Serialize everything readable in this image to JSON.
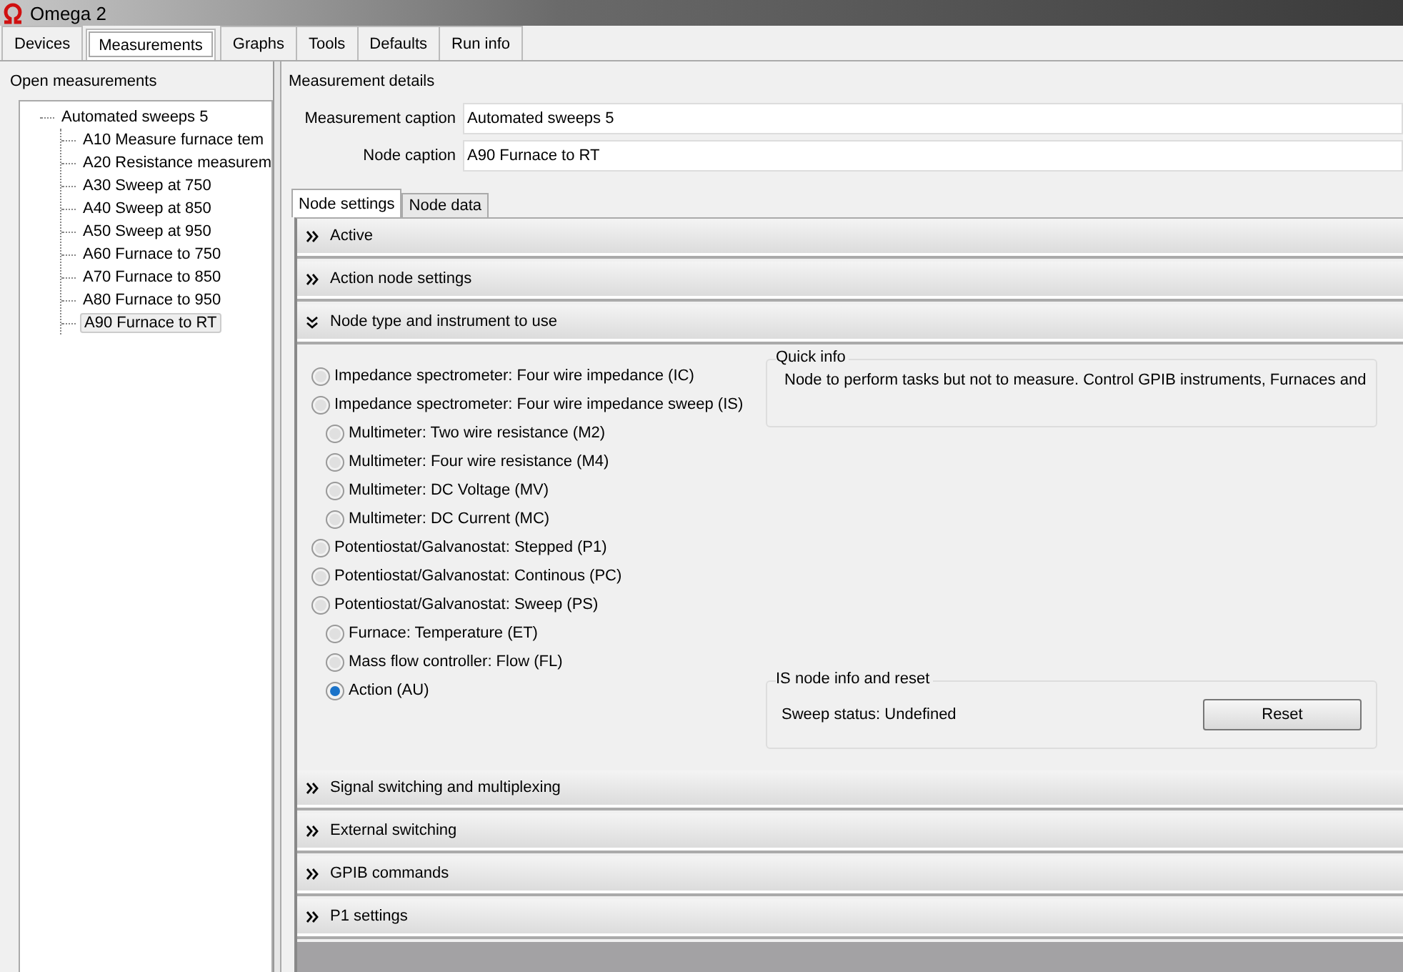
{
  "window": {
    "title": "Omega 2"
  },
  "tabs": [
    {
      "label": "Devices",
      "selected": false
    },
    {
      "label": "Measurements",
      "selected": true
    },
    {
      "label": "Graphs",
      "selected": false
    },
    {
      "label": "Tools",
      "selected": false
    },
    {
      "label": "Defaults",
      "selected": false
    },
    {
      "label": "Run info",
      "selected": false
    }
  ],
  "open_measurements": {
    "title": "Open measurements",
    "tree": [
      {
        "label": "Automated sweeps 5",
        "selected": false,
        "children": [
          {
            "label": "A10 Measure furnace tem",
            "selected": false
          },
          {
            "label": "A20 Resistance measurem",
            "selected": false
          },
          {
            "label": "A30 Sweep at 750",
            "selected": false
          },
          {
            "label": "A40 Sweep at 850",
            "selected": false
          },
          {
            "label": "A50 Sweep at 950",
            "selected": false
          },
          {
            "label": "A60 Furnace to 750",
            "selected": false
          },
          {
            "label": "A70 Furnace to 850",
            "selected": false
          },
          {
            "label": "A80 Furnace to 950",
            "selected": false
          },
          {
            "label": "A90 Furnace to RT",
            "selected": true
          }
        ]
      }
    ]
  },
  "measurement_details": {
    "title": "Measurement details",
    "fields": [
      {
        "label": "Measurement caption",
        "value": "Automated sweeps 5"
      },
      {
        "label": "Node caption",
        "value": "A90 Furnace to RT"
      }
    ]
  },
  "node_tabs": [
    {
      "label": "Node settings",
      "selected": true
    },
    {
      "label": "Node data",
      "selected": false
    }
  ],
  "sections": [
    {
      "title": "Active",
      "expanded": false
    },
    {
      "title": "Action node settings",
      "expanded": false
    },
    {
      "title": "Node type and instrument to use",
      "expanded": true,
      "content": {
        "options": [
          {
            "label": "Impedance spectrometer: Four wire impedance (IC)",
            "indented": false,
            "selected": false
          },
          {
            "label": "Impedance spectrometer: Four wire impedance sweep (IS)",
            "indented": false,
            "selected": false
          },
          {
            "label": "Multimeter: Two wire resistance (M2)",
            "indented": true,
            "selected": false
          },
          {
            "label": "Multimeter: Four wire resistance (M4)",
            "indented": true,
            "selected": false
          },
          {
            "label": "Multimeter: DC Voltage (MV)",
            "indented": true,
            "selected": false
          },
          {
            "label": "Multimeter: DC Current (MC)",
            "indented": true,
            "selected": false
          },
          {
            "label": "Potentiostat/Galvanostat: Stepped (P1)",
            "indented": false,
            "selected": false
          },
          {
            "label": "Potentiostat/Galvanostat: Continous (PC)",
            "indented": false,
            "selected": false
          },
          {
            "label": "Potentiostat/Galvanostat: Sweep (PS)",
            "indented": false,
            "selected": false
          },
          {
            "label": "Furnace: Temperature (ET)",
            "indented": true,
            "selected": false
          },
          {
            "label": "Mass flow controller: Flow (FL)",
            "indented": true,
            "selected": false
          },
          {
            "label": "Action (AU)",
            "indented": true,
            "selected": true
          }
        ],
        "quick_info": {
          "title": "Quick info",
          "text": "Node to perform tasks but not to measure. Control GPIB instruments, Furnaces and"
        },
        "is_node_info": {
          "title": "IS node info and reset",
          "status": "Sweep status: Undefined",
          "button": "Reset"
        }
      }
    },
    {
      "title": "Signal switching and multiplexing",
      "expanded": false
    },
    {
      "title": "External switching",
      "expanded": false
    },
    {
      "title": "GPIB commands",
      "expanded": false
    },
    {
      "title": "P1 settings",
      "expanded": false
    }
  ]
}
